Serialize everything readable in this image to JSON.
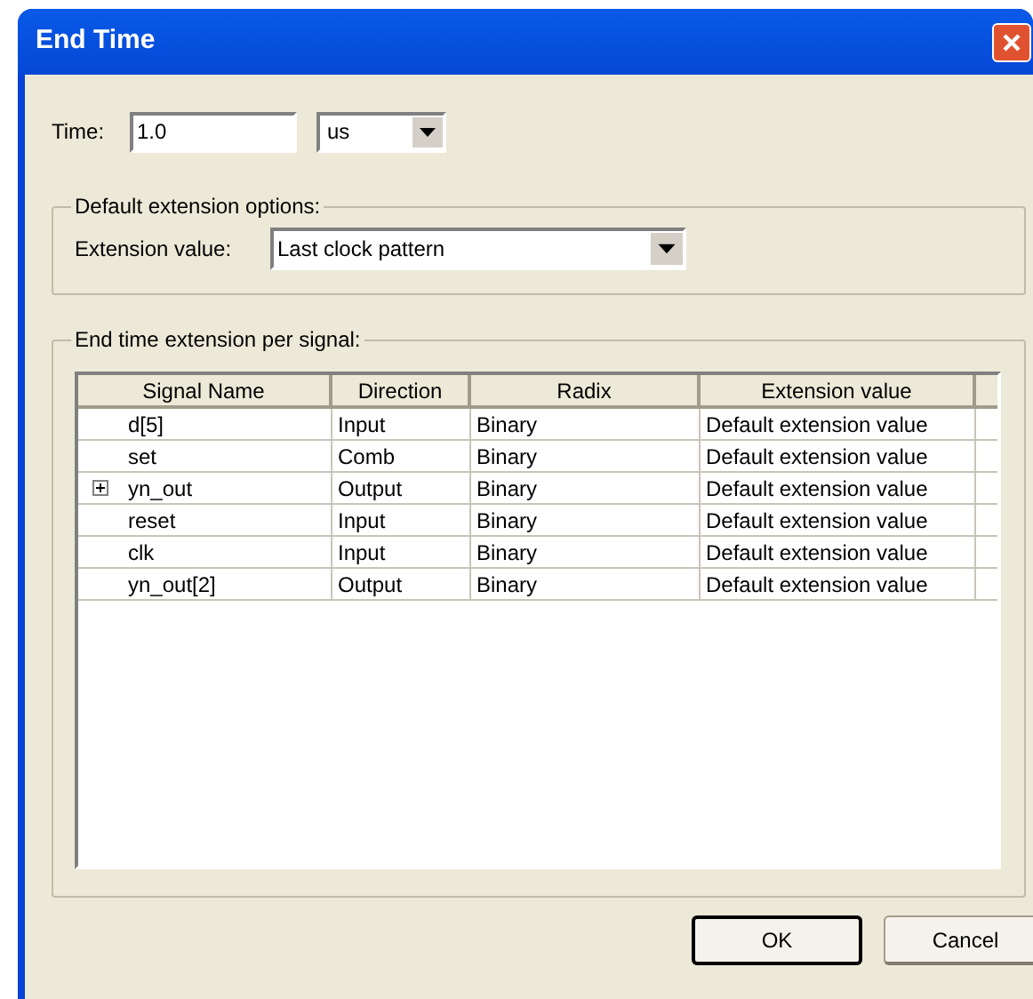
{
  "window": {
    "title": "End Time"
  },
  "time": {
    "label": "Time:",
    "value": "1.0",
    "unit": "us"
  },
  "default_options": {
    "legend": "Default extension options:",
    "label": "Extension value:",
    "value": "Last clock pattern"
  },
  "per_signal": {
    "legend": "End time extension per signal:",
    "columns": [
      "Signal Name",
      "Direction",
      "Radix",
      "Extension value"
    ],
    "rows": [
      {
        "name": "d[5]",
        "direction": "Input",
        "radix": "Binary",
        "extension": "Default extension value"
      },
      {
        "name": "set",
        "direction": "Comb",
        "radix": "Binary",
        "extension": "Default extension value"
      },
      {
        "name": "yn_out",
        "direction": "Output",
        "radix": "Binary",
        "extension": "Default extension value",
        "expanded": false
      },
      {
        "name": "reset",
        "direction": "Input",
        "radix": "Binary",
        "extension": "Default extension value"
      },
      {
        "name": "clk",
        "direction": "Input",
        "radix": "Binary",
        "extension": "Default extension value"
      },
      {
        "name": "yn_out[2]",
        "direction": "Output",
        "radix": "Binary",
        "extension": "Default extension value"
      }
    ]
  },
  "buttons": [
    "OK",
    "Cancel"
  ]
}
